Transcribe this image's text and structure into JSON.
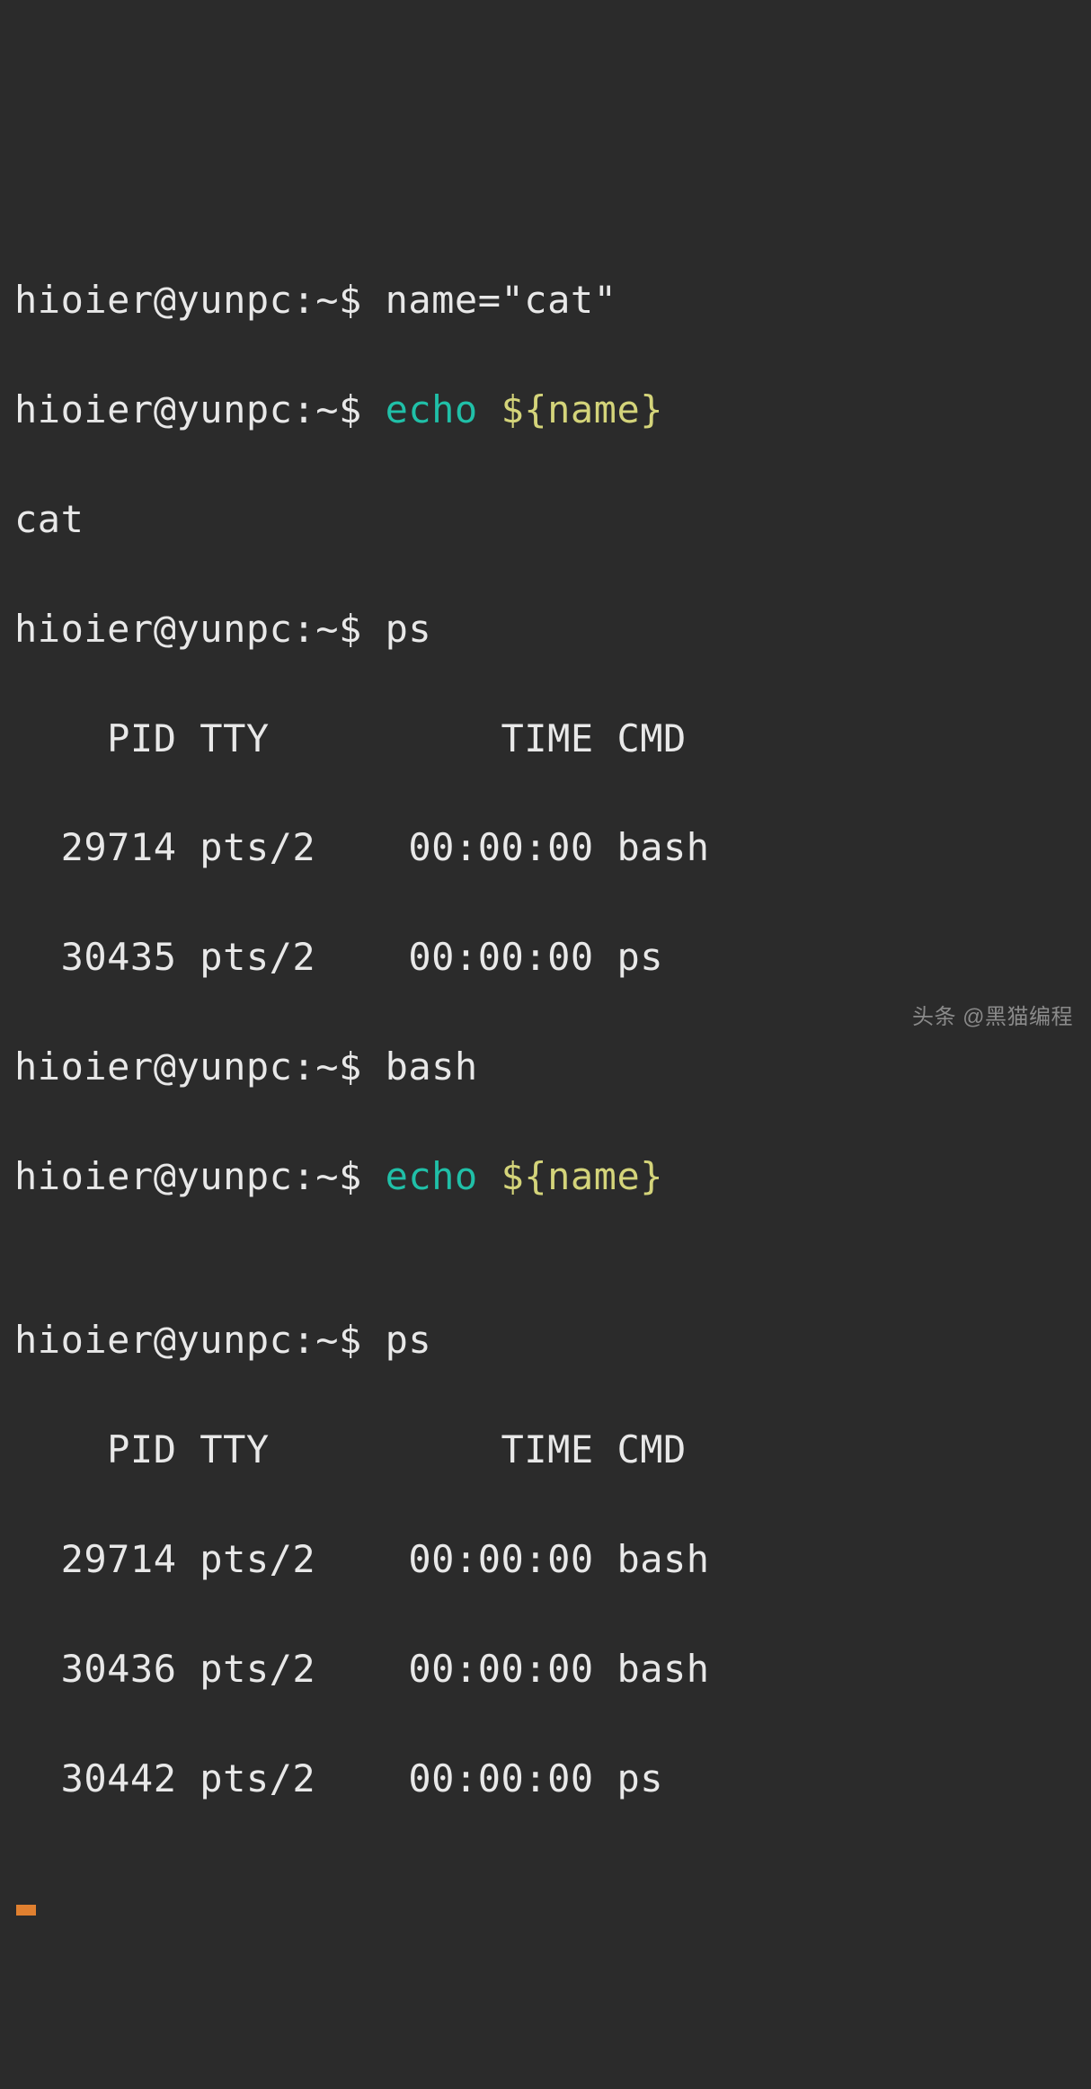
{
  "lines": {
    "l1_prompt": "hioier@yunpc:~$ ",
    "l1_cmd": "name=\"cat\"",
    "l2_prompt": "hioier@yunpc:~$ ",
    "l2_echo": "echo",
    "l2_var": " ${name}",
    "l3_output": "cat",
    "l4_prompt": "hioier@yunpc:~$ ",
    "l4_cmd": "ps",
    "ps1_header": "    PID TTY          TIME CMD",
    "ps1_r1": "  29714 pts/2    00:00:00 bash",
    "ps1_r2": "  30435 pts/2    00:00:00 ps",
    "l8_prompt": "hioier@yunpc:~$ ",
    "l8_cmd": "bash",
    "l9_prompt": "hioier@yunpc:~$ ",
    "l9_echo": "echo",
    "l9_var": " ${name}",
    "l10_output": "",
    "l11_prompt": "hioier@yunpc:~$ ",
    "l11_cmd": "ps",
    "ps2_header": "    PID TTY          TIME CMD",
    "ps2_r1": "  29714 pts/2    00:00:00 bash",
    "ps2_r2": "  30436 pts/2    00:00:00 bash",
    "ps2_r3": "  30442 pts/2    00:00:00 ps"
  },
  "watermark": "头条 @黑猫编程"
}
